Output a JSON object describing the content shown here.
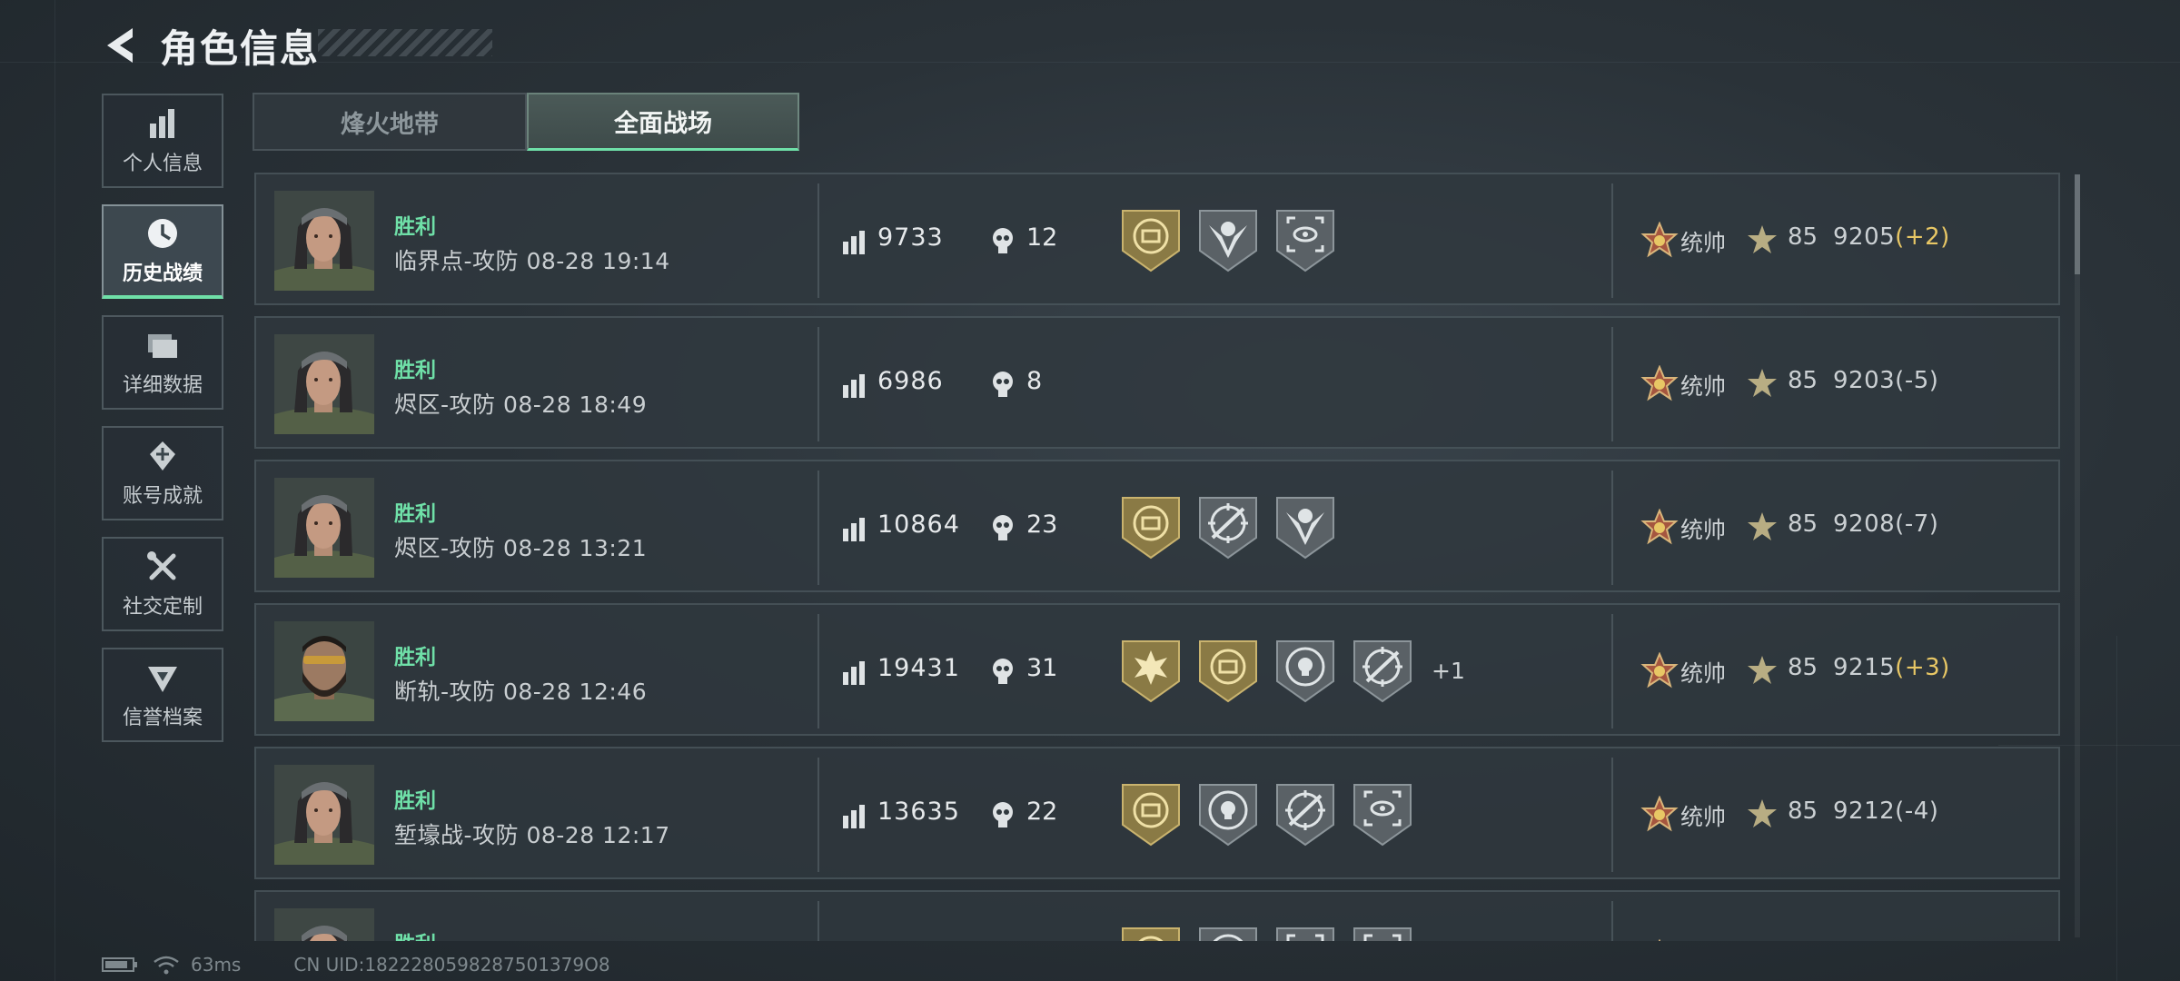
{
  "header": {
    "title": "角色信息"
  },
  "sidebar": {
    "items": [
      {
        "label": "个人信息",
        "icon": "bar-chart-icon",
        "active": false
      },
      {
        "label": "历史战绩",
        "icon": "clock-icon",
        "active": true
      },
      {
        "label": "详细数据",
        "icon": "folder-icon",
        "active": false
      },
      {
        "label": "账号成就",
        "icon": "achievement-icon",
        "active": false
      },
      {
        "label": "社交定制",
        "icon": "tools-icon",
        "active": false
      },
      {
        "label": "信誉档案",
        "icon": "credit-shield-icon",
        "active": false
      }
    ]
  },
  "tabs": [
    {
      "label": "烽火地带",
      "active": false
    },
    {
      "label": "全面战场",
      "active": true
    }
  ],
  "matches": [
    {
      "result": "胜利",
      "info": "临界点-攻防 08-28 19:14",
      "score": "9733",
      "kills": "12",
      "medals": [
        "gold-banner-medal",
        "eagle-medal",
        "scope-medal"
      ],
      "more": "",
      "rank": "统帅",
      "level": "85",
      "rating": "9205",
      "delta": "(+2)",
      "delta_dir": "up"
    },
    {
      "result": "胜利",
      "info": "烬区-攻防 08-28 18:49",
      "score": "6986",
      "kills": "8",
      "medals": [],
      "more": "",
      "rank": "统帅",
      "level": "85",
      "rating": "9203",
      "delta": "(-5)",
      "delta_dir": "down"
    },
    {
      "result": "胜利",
      "info": "烬区-攻防 08-28 13:21",
      "score": "10864",
      "kills": "23",
      "medals": [
        "gold-banner-medal",
        "rifle-crosshair-medal",
        "eagle-medal"
      ],
      "more": "",
      "rank": "统帅",
      "level": "85",
      "rating": "9208",
      "delta": "(-7)",
      "delta_dir": "down"
    },
    {
      "result": "胜利",
      "info": "断轨-攻防 08-28 12:46",
      "score": "19431",
      "kills": "31",
      "medals": [
        "gold-burst-medal",
        "gold-banner-medal",
        "skull-target-medal",
        "rifle-crosshair-medal"
      ],
      "more": "+1",
      "rank": "统帅",
      "level": "85",
      "rating": "9215",
      "delta": "(+3)",
      "delta_dir": "up"
    },
    {
      "result": "胜利",
      "info": "堑壕战-攻防 08-28 12:17",
      "score": "13635",
      "kills": "22",
      "medals": [
        "gold-banner-medal",
        "skull-target-medal",
        "rifle-crosshair-medal",
        "scope-medal"
      ],
      "more": "",
      "rank": "统帅",
      "level": "85",
      "rating": "9212",
      "delta": "(-4)",
      "delta_dir": "down"
    },
    {
      "result": "胜利",
      "info": "",
      "score": "",
      "kills": "",
      "medals": [
        "gold-banner-medal",
        "skull-target-medal",
        "scope-medal",
        "scope-medal"
      ],
      "more": "",
      "rank": "",
      "level": "",
      "rating": "",
      "delta": "",
      "delta_dir": "down"
    }
  ],
  "status": {
    "ping": "63ms",
    "uid": "CN UID:1822280598287501379O8"
  },
  "colors": {
    "accent_green": "#6fe0a8",
    "gain_gold": "#e8c765",
    "medal_gold": "#8a7a45",
    "medal_grey": "#5a6166"
  }
}
